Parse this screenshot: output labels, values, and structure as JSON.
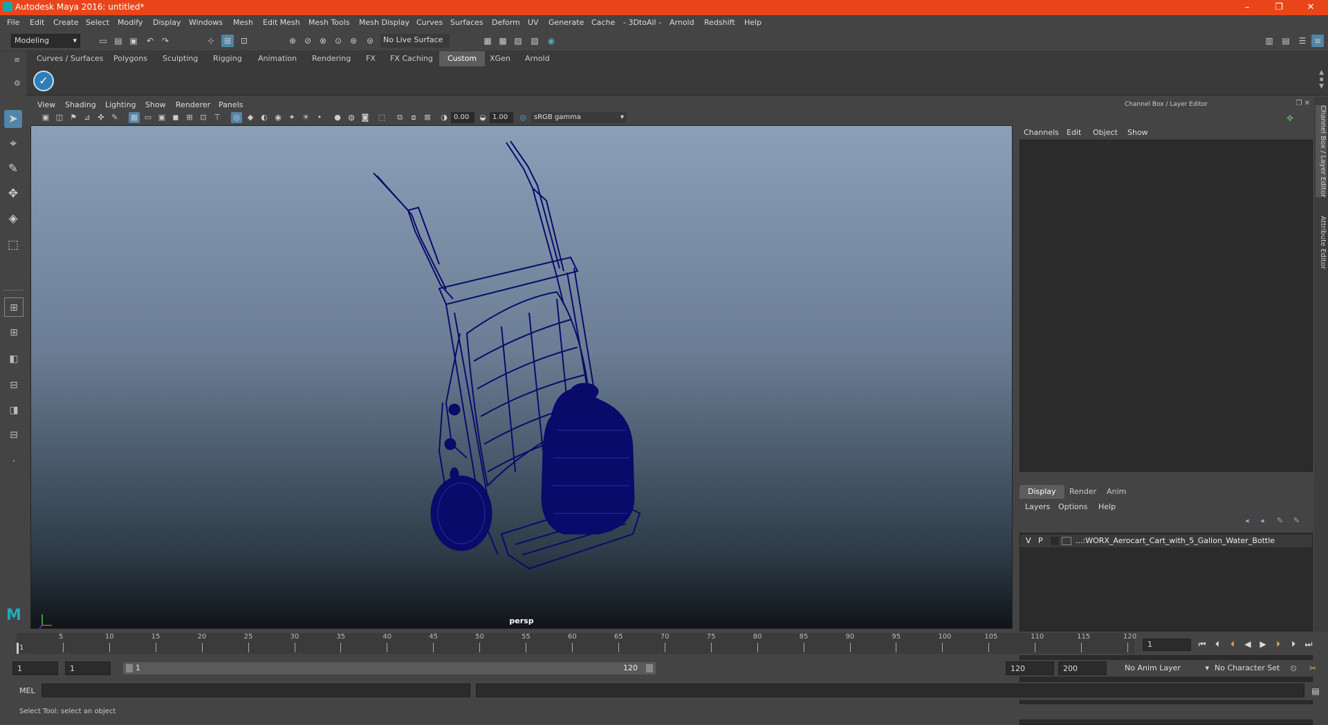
{
  "window": {
    "title": "Autodesk Maya 2016: untitled*"
  },
  "menubar": {
    "items": [
      "File",
      "Edit",
      "Create",
      "Select",
      "Modify",
      "Display",
      "Windows",
      "Mesh",
      "Edit Mesh",
      "Mesh Tools",
      "Mesh Display",
      "Curves",
      "Surfaces",
      "Deform",
      "UV",
      "Generate",
      "Cache",
      "- 3DtoAll -",
      "Arnold",
      "Redshift",
      "Help"
    ]
  },
  "statusline": {
    "mode": "Modeling",
    "live_surface": "No Live Surface"
  },
  "shelf": {
    "tabs": [
      "Curves / Surfaces",
      "Polygons",
      "Sculpting",
      "Rigging",
      "Animation",
      "Rendering",
      "FX",
      "FX Caching",
      "Custom",
      "XGen",
      "Arnold"
    ],
    "active_tab": "Custom"
  },
  "panel": {
    "menu": [
      "View",
      "Shading",
      "Lighting",
      "Show",
      "Renderer",
      "Panels"
    ],
    "exposure": "0.00",
    "gamma": "1.00",
    "colorspace": "sRGB gamma",
    "camera_label": "persp"
  },
  "channelbox": {
    "title": "Channel Box / Layer Editor",
    "menu": [
      "Channels",
      "Edit",
      "Object",
      "Show"
    ]
  },
  "layers": {
    "tabs": [
      "Display",
      "Render",
      "Anim"
    ],
    "active_tab": "Display",
    "menu": [
      "Layers",
      "Options",
      "Help"
    ],
    "rows": [
      {
        "v": "V",
        "p": "P",
        "name": "...:WORX_Aerocart_Cart_with_5_Gallon_Water_Bottle"
      }
    ]
  },
  "sidetabs": [
    "Channel Box / Layer Editor",
    "Attribute Editor"
  ],
  "timeline": {
    "ticks": [
      5,
      10,
      15,
      20,
      25,
      30,
      35,
      40,
      45,
      50,
      55,
      60,
      65,
      70,
      75,
      80,
      85,
      90,
      95,
      100,
      105,
      110,
      115,
      120
    ],
    "start_marker": "1",
    "current_frame": "1"
  },
  "range": {
    "start": "1",
    "playback_start": "1",
    "slider_start": "1",
    "slider_end": "120",
    "playback_end": "120",
    "end": "200",
    "anim_layer": "No Anim Layer",
    "character_set": "No Character Set"
  },
  "cmdline": {
    "label": "MEL"
  },
  "helpline": {
    "text": "Select Tool: select an object"
  },
  "colors": {
    "titlebar": "#e8461a",
    "accent": "#5285a6",
    "wireframe": "#0a0a6a"
  }
}
